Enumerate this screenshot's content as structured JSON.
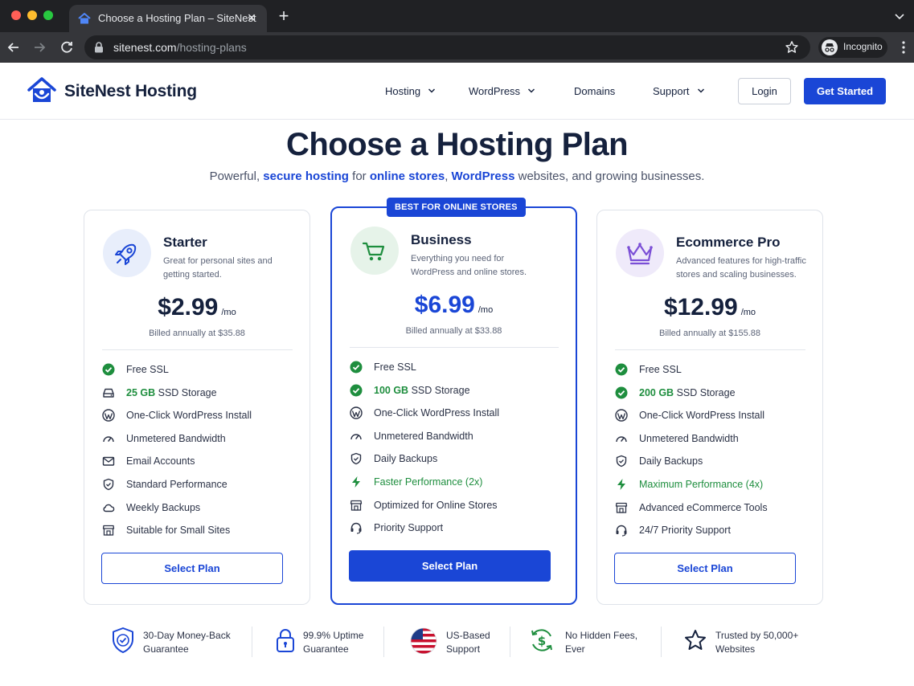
{
  "browser": {
    "tab_title": "Choose a Hosting Plan – SiteNest",
    "url_host": "sitenest.com",
    "url_path": "/hosting-plans",
    "profile_label": "Incognito"
  },
  "header": {
    "brand": "SiteNest Hosting",
    "nav": [
      {
        "label": "Hosting",
        "has_dropdown": true
      },
      {
        "label": "WordPress",
        "has_dropdown": true
      },
      {
        "label": "Domains",
        "has_dropdown": false
      },
      {
        "label": "Support",
        "has_dropdown": true
      }
    ],
    "login_label": "Login",
    "cta_label": "Get Started"
  },
  "hero": {
    "title": "Choose a Hosting Plan",
    "subtitle_parts": [
      {
        "text": "Powerful, ",
        "highlight": false
      },
      {
        "text": "secure hosting",
        "highlight": true
      },
      {
        "text": " for ",
        "highlight": false
      },
      {
        "text": "online stores",
        "highlight": true
      },
      {
        "text": ", ",
        "highlight": false
      },
      {
        "text": "WordPress",
        "highlight": true
      },
      {
        "text": " websites, and growing businesses.",
        "highlight": false
      }
    ]
  },
  "plans": [
    {
      "name": "Starter",
      "description": "Great for personal sites and getting started.",
      "icon": "rocket-icon",
      "price": "$2.99",
      "period": "/mo",
      "billed": "Billed annually at $35.88",
      "featured": false,
      "features": [
        {
          "icon": "check-circle-icon",
          "parts": [
            {
              "text": "Free SSL"
            }
          ]
        },
        {
          "icon": "hard-drive-icon",
          "parts": [
            {
              "text": "25 GB",
              "style": "green-bold"
            },
            {
              "text": " SSD Storage"
            }
          ]
        },
        {
          "icon": "wordpress-icon",
          "parts": [
            {
              "text": "One-Click WordPress Install"
            }
          ]
        },
        {
          "icon": "gauge-icon",
          "parts": [
            {
              "text": "Unmetered Bandwidth"
            }
          ]
        },
        {
          "icon": "mail-icon",
          "parts": [
            {
              "text": "Email Accounts"
            }
          ]
        },
        {
          "icon": "shield-icon",
          "parts": [
            {
              "text": "Standard Performance"
            }
          ]
        },
        {
          "icon": "cloud-icon",
          "parts": [
            {
              "text": "Weekly Backups"
            }
          ]
        },
        {
          "icon": "storefront-icon",
          "parts": [
            {
              "text": "Suitable for Small Sites"
            }
          ]
        }
      ],
      "button_label": "Select Plan"
    },
    {
      "name": "Business",
      "description": "Everything you need for WordPress and online stores.",
      "icon": "cart-icon",
      "price": "$6.99",
      "period": "/mo",
      "billed": "Billed annually at $33.88",
      "featured": true,
      "badge": "BEST FOR ONLINE STORES",
      "features": [
        {
          "icon": "check-circle-icon",
          "parts": [
            {
              "text": "Free SSL"
            }
          ]
        },
        {
          "icon": "check-circle-icon",
          "parts": [
            {
              "text": "100 GB",
              "style": "green-bold"
            },
            {
              "text": " SSD Storage"
            }
          ]
        },
        {
          "icon": "wordpress-icon",
          "parts": [
            {
              "text": "One-Click WordPress Install"
            }
          ]
        },
        {
          "icon": "gauge-icon",
          "parts": [
            {
              "text": "Unmetered Bandwidth"
            }
          ]
        },
        {
          "icon": "shield-icon",
          "parts": [
            {
              "text": "Daily Backups"
            }
          ]
        },
        {
          "icon": "bolt-icon",
          "parts": [
            {
              "text": "Faster Performance (2x)",
              "style": "green"
            }
          ]
        },
        {
          "icon": "storefront-icon",
          "parts": [
            {
              "text": "Optimized for Online Stores"
            }
          ]
        },
        {
          "icon": "headset-icon",
          "parts": [
            {
              "text": "Priority Support"
            }
          ]
        }
      ],
      "button_label": "Select Plan"
    },
    {
      "name": "Ecommerce Pro",
      "description": "Advanced features for high-traffic stores and scaling businesses.",
      "icon": "crown-icon",
      "price": "$12.99",
      "period": "/mo",
      "billed": "Billed annually at $155.88",
      "featured": false,
      "features": [
        {
          "icon": "check-circle-icon",
          "parts": [
            {
              "text": "Free SSL"
            }
          ]
        },
        {
          "icon": "check-circle-icon",
          "parts": [
            {
              "text": "200 GB",
              "style": "green-bold"
            },
            {
              "text": " SSD Storage"
            }
          ]
        },
        {
          "icon": "wordpress-icon",
          "parts": [
            {
              "text": "One-Click WordPress Install"
            }
          ]
        },
        {
          "icon": "gauge-icon",
          "parts": [
            {
              "text": "Unmetered Bandwidth"
            }
          ]
        },
        {
          "icon": "shield-icon",
          "parts": [
            {
              "text": "Daily Backups"
            }
          ]
        },
        {
          "icon": "bolt-icon",
          "parts": [
            {
              "text": "Maximum Performance (4x)",
              "style": "green"
            }
          ]
        },
        {
          "icon": "storefront-icon",
          "parts": [
            {
              "text": "Advanced eCommerce Tools"
            }
          ]
        },
        {
          "icon": "headset-icon",
          "parts": [
            {
              "text": "24/7 Priority Support"
            }
          ]
        }
      ],
      "button_label": "Select Plan"
    }
  ],
  "trust": [
    {
      "icon": "shield-check-icon",
      "line1": "30-Day Money-Back",
      "line2": "Guarantee"
    },
    {
      "icon": "padlock-icon",
      "line1": "99.9% Uptime",
      "line2": "Guarantee"
    },
    {
      "icon": "us-flag-icon",
      "line1": "US-Based",
      "line2": "Support"
    },
    {
      "icon": "dollar-cycle-icon",
      "line1": "No Hidden Fees,",
      "line2": "Ever"
    },
    {
      "icon": "star-icon",
      "line1": "Trusted by 50,000+",
      "line2": "Websites"
    }
  ],
  "colors": {
    "brand": "#1a46d6",
    "text": "#15213d",
    "success": "#1e8e3e",
    "starter_icon_bg": "#e8eefb",
    "business_icon_bg": "#e6f3e9",
    "pro_icon_bg": "#efeafa"
  }
}
